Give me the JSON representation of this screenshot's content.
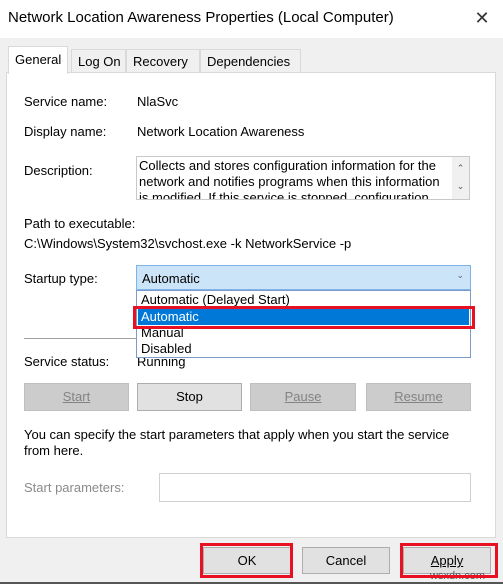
{
  "window": {
    "title": "Network Location Awareness Properties (Local Computer)",
    "close_icon": "close-icon"
  },
  "tabs": [
    {
      "label": "General",
      "active": true
    },
    {
      "label": "Log On",
      "active": false
    },
    {
      "label": "Recovery",
      "active": false
    },
    {
      "label": "Dependencies",
      "active": false
    }
  ],
  "general": {
    "service_name_label": "Service name:",
    "service_name_value": "NlaSvc",
    "display_name_label": "Display name:",
    "display_name_value": "Network Location Awareness",
    "description_label": "Description:",
    "description_value": "Collects and stores configuration information for the network and notifies programs when this information is modified. If this service is stopped, configuration",
    "path_label": "Path to executable:",
    "path_value": "C:\\Windows\\System32\\svchost.exe -k NetworkService -p",
    "startup_type_label": "Startup type:",
    "startup_type_value": "Automatic",
    "startup_options": [
      {
        "label": "Automatic (Delayed Start)",
        "selected": false
      },
      {
        "label": "Automatic",
        "selected": true
      },
      {
        "label": "Manual",
        "selected": false
      },
      {
        "label": "Disabled",
        "selected": false
      }
    ],
    "service_status_label": "Service status:",
    "service_status_value": "Running",
    "buttons": {
      "start": {
        "label": "Start",
        "enabled": false
      },
      "stop": {
        "label": "Stop",
        "enabled": true
      },
      "pause": {
        "label": "Pause",
        "enabled": false
      },
      "resume": {
        "label": "Resume",
        "enabled": false
      }
    },
    "info_text": "You can specify the start parameters that apply when you start the service from here.",
    "start_params_label": "Start parameters:",
    "start_params_value": ""
  },
  "footer": {
    "ok_label": "OK",
    "cancel_label": "Cancel",
    "apply_label": "Apply"
  },
  "annotations": {
    "highlight_color": "#e81123"
  },
  "watermark": "wsxdn.com"
}
